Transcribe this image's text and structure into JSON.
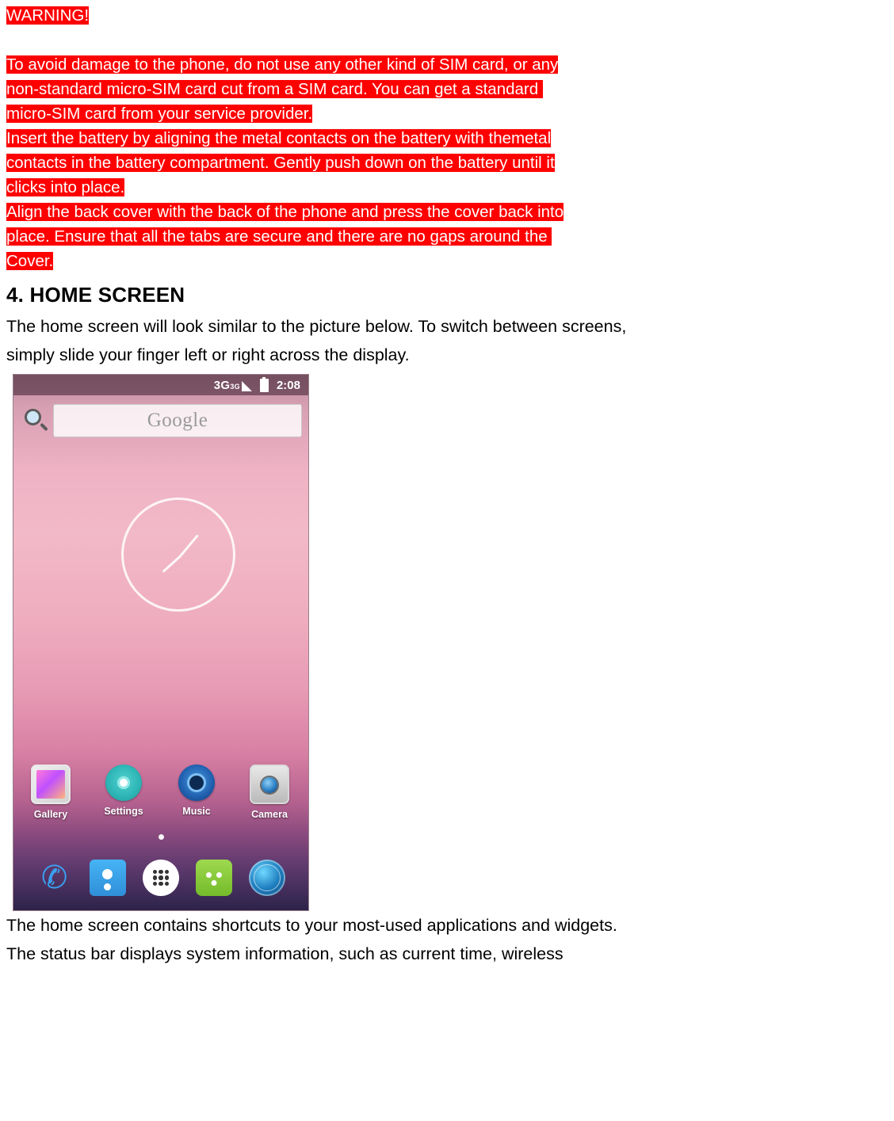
{
  "document": {
    "warning_heading": "WARNING!",
    "warning_paragraphs": [
      "To avoid damage to the phone, do not use any other kind of SIM card, or any",
      "non-standard micro-SIM card cut from a SIM card. You can get a standard ",
      "micro-SIM card from your service provider.",
      "Insert the battery by aligning the metal contacts on the battery with themetal",
      "contacts in the battery compartment. Gently push down on the battery until it",
      "clicks into place.",
      "Align the back cover with the back of the phone and press the cover back into",
      "place. Ensure that all the tabs are secure and there are no gaps around the ",
      "Cover."
    ],
    "section_title": "4. HOME SCREEN",
    "intro_lines": [
      "The home screen will look similar to the picture below. To switch between screens,",
      "simply slide your finger left or right across the display."
    ],
    "closing_lines": [
      "The home screen contains shortcuts to your most-used applications and widgets.",
      "The status bar displays system information, such as current time, wireless"
    ]
  },
  "phone_screenshot": {
    "status_bar": {
      "network_label": "3G",
      "network_superscript": "3G",
      "signal_icon": "signal-triangle-icon",
      "battery_icon": "battery-icon",
      "clock": "2:08"
    },
    "search_widget": {
      "icon": "magnifier-icon",
      "brand_text": "Google"
    },
    "clock_widget": {
      "icon": "analog-clock-widget"
    },
    "apps": [
      {
        "label": "Gallery",
        "icon": "gallery-icon"
      },
      {
        "label": "Settings",
        "icon": "settings-icon"
      },
      {
        "label": "Music",
        "icon": "music-icon"
      },
      {
        "label": "Camera",
        "icon": "camera-icon"
      }
    ],
    "page_indicator": "page-dot",
    "dock": [
      {
        "name": "phone-icon",
        "glyph": "✆"
      },
      {
        "name": "contacts-icon"
      },
      {
        "name": "app-drawer-icon"
      },
      {
        "name": "messaging-icon"
      },
      {
        "name": "browser-icon"
      }
    ]
  },
  "colors": {
    "highlight_background": "#FF0000",
    "highlight_text": "#FFFFFF",
    "body_text": "#000000"
  }
}
